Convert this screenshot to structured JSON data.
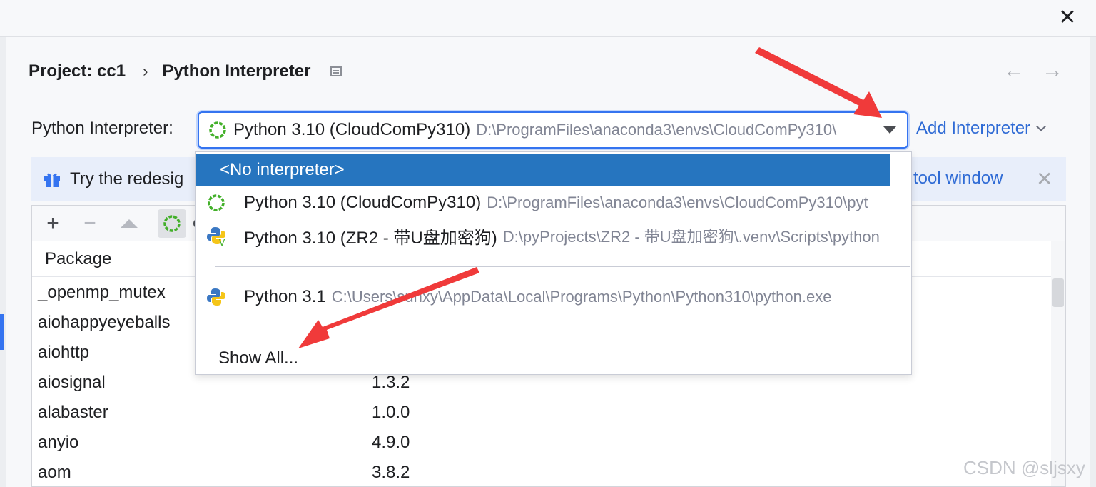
{
  "window": {
    "close_glyph": "✕"
  },
  "breadcrumb": {
    "project": "Project: cc1",
    "separator": "›",
    "page": "Python Interpreter"
  },
  "nav": {
    "back_glyph": "←",
    "forward_glyph": "→"
  },
  "interpreter": {
    "label": "Python Interpreter:",
    "selected_name": "Python 3.10 (CloudComPy310)",
    "selected_path": "D:\\ProgramFiles\\anaconda3\\envs\\CloudComPy310\\",
    "add_label": "Add Interpreter"
  },
  "banner": {
    "text": "Try the redesig",
    "link": "tool window",
    "close_glyph": "✕"
  },
  "toolbar": {
    "add_glyph": "+",
    "remove_glyph": "−"
  },
  "table": {
    "header": "Package",
    "rows": [
      {
        "name": "_openmp_mutex",
        "version": ""
      },
      {
        "name": "aiohappyeyeballs",
        "version": ""
      },
      {
        "name": "aiohttp",
        "version": ""
      },
      {
        "name": "aiosignal",
        "version": "1.3.2"
      },
      {
        "name": "alabaster",
        "version": "1.0.0"
      },
      {
        "name": "anyio",
        "version": "4.9.0"
      },
      {
        "name": "aom",
        "version": "3.8.2"
      }
    ]
  },
  "dropdown": {
    "no_interpreter": "<No interpreter>",
    "items": [
      {
        "name": "Python 3.10 (CloudComPy310)",
        "path": "D:\\ProgramFiles\\anaconda3\\envs\\CloudComPy310\\pyt",
        "icon": "conda-icon"
      },
      {
        "name": "Python 3.10 (ZR2 - 带U盘加密狗)",
        "path": "D:\\pyProjects\\ZR2 - 带U盘加密狗\\.venv\\Scripts\\python",
        "icon": "python-venv-icon"
      },
      {
        "name": "Python 3.1",
        "path": "C:\\Users\\sunxy\\AppData\\Local\\Programs\\Python\\Python310\\python.exe",
        "icon": "python-icon"
      }
    ],
    "show_all": "Show All..."
  },
  "watermark": "CSDN @sljsxy",
  "colors": {
    "accent": "#3574f0",
    "selection": "#2675bf",
    "annotation_arrow": "#f03a3a"
  }
}
